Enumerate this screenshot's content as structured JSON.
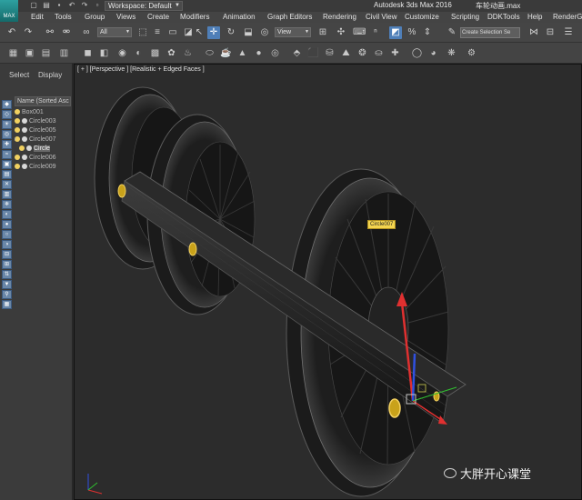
{
  "titlebar": {
    "logo_text": "MAX",
    "workspace_label": "Workspace: Default",
    "app_title": "Autodesk 3ds Max 2016",
    "file_title": "车轮动画.max"
  },
  "menu": [
    "Edit",
    "Tools",
    "Group",
    "Views",
    "Create",
    "Modifiers",
    "Animation",
    "Graph Editors",
    "Rendering",
    "Civil View",
    "Customize",
    "Scripting",
    "DDKTools",
    "Help",
    "RenderG"
  ],
  "toolbar": {
    "filter_value": "All",
    "ref_coord_value": "View",
    "selection_set_placeholder": "Create Selection Se"
  },
  "explorer": {
    "tabs": [
      "Select",
      "Display"
    ],
    "column_header": "Name (Sorted Asc",
    "items": [
      {
        "name": "Box001",
        "depth": 0,
        "selected": false
      },
      {
        "name": "Circle003",
        "depth": 0,
        "selected": false
      },
      {
        "name": "Circle005",
        "depth": 0,
        "selected": false
      },
      {
        "name": "Circle007",
        "depth": 0,
        "selected": false,
        "expanded": true
      },
      {
        "name": "Circle",
        "depth": 1,
        "selected": true
      },
      {
        "name": "Circle006",
        "depth": 0,
        "selected": false
      },
      {
        "name": "Circle009",
        "depth": 0,
        "selected": false
      }
    ]
  },
  "viewport": {
    "label": "[ + ] [Perspective ] [Realistic + Edged Faces ]",
    "selected_object_tag": "Circle007"
  },
  "watermark": {
    "text": "大胖开心课堂"
  },
  "colors": {
    "accent": "#4f7fb8",
    "tag": "#f3d44f",
    "gizmo_y": "#e03030",
    "gizmo_z": "#3050e0",
    "gizmo_x": "#30c030"
  }
}
